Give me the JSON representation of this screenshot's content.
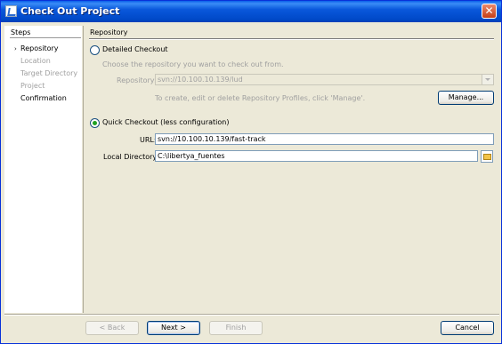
{
  "window": {
    "title": "Check Out Project",
    "close_glyph": "✕",
    "icon": "app-icon"
  },
  "steps": {
    "title": "Steps",
    "current_marker": "›",
    "items": [
      {
        "label": "Repository",
        "state": "current"
      },
      {
        "label": "Location",
        "state": "disabled"
      },
      {
        "label": "Target Directory",
        "state": "disabled"
      },
      {
        "label": "Project",
        "state": "disabled"
      },
      {
        "label": "Confirmation",
        "state": "enabled"
      }
    ]
  },
  "main": {
    "section_title": "Repository",
    "detailed": {
      "label": "Detailed Checkout",
      "selected": false,
      "hint": "Choose the repository you want to check out from.",
      "repository_label": "Repository:",
      "repository_value": "svn://10.100.10.139/lud",
      "profiles_hint": "To create, edit or delete Repository Profiles, click 'Manage'.",
      "manage_label": "Manage..."
    },
    "quick": {
      "label": "Quick Checkout (less configuration)",
      "selected": true,
      "url_label": "URL:",
      "url_value": "svn://10.100.10.139/fast-track",
      "local_dir_label": "Local Directory:",
      "local_dir_value": "C:\\libertya_fuentes"
    }
  },
  "footer": {
    "back_label": "< Back",
    "next_label": "Next >",
    "finish_label": "Finish",
    "cancel_label": "Cancel"
  },
  "colors": {
    "title_bar": "#0054e3",
    "accent_radio": "#21a121",
    "dialog_bg": "#ece9d8"
  }
}
